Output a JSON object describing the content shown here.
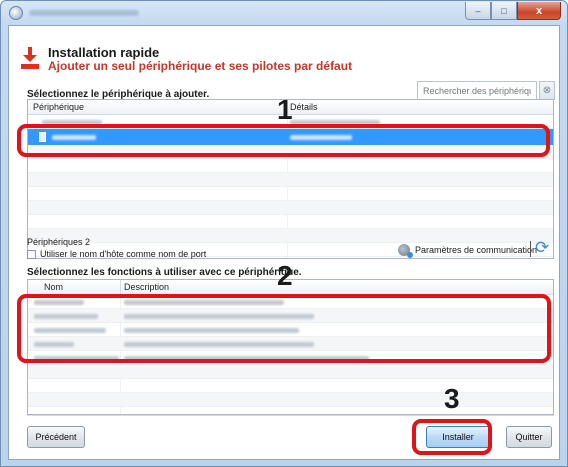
{
  "window": {
    "close_glyph": "x",
    "minimize_glyph": "–",
    "maximize_glyph": "□"
  },
  "header": {
    "title": "Installation rapide",
    "subtitle": "Ajouter un seul périphérique et ses pilotes par défaut"
  },
  "device_section": {
    "label": "Sélectionnez le périphérique à ajouter.",
    "search_placeholder": "Rechercher des périphériques",
    "columns": [
      "Périphérique",
      "Détails"
    ],
    "count_label": "Périphériques 2",
    "hostname_checkbox": {
      "label": "Utiliser le nom d'hôte comme nom de port",
      "checked": false
    },
    "comm_params_label": "Paramètres de communication"
  },
  "function_section": {
    "label": "Sélectionnez les fonctions à utiliser avec ce périphérique.",
    "columns": [
      "Nom",
      "Description"
    ]
  },
  "buttons": {
    "previous": "Précédent",
    "install": "Installer",
    "quit": "Quitter"
  },
  "callouts": [
    "1",
    "2",
    "3"
  ],
  "colors": {
    "accent_red": "#e0121a",
    "selection_blue": "#3399ff",
    "subtitle_red": "#c0392b"
  }
}
